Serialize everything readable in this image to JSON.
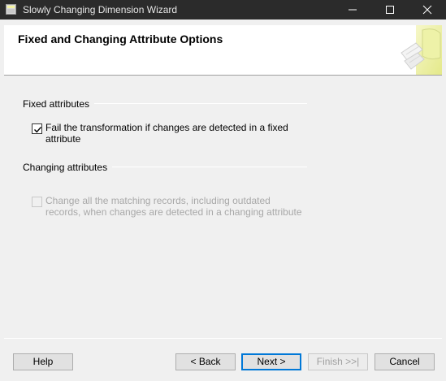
{
  "window": {
    "title": "Slowly Changing Dimension Wizard",
    "icon": "wizard-app-icon",
    "controls": {
      "minimize": "minimize-icon",
      "maximize": "maximize-icon",
      "close": "close-icon"
    }
  },
  "header": {
    "title": "Fixed and Changing Attribute Options",
    "art": "wizard-header-graphic"
  },
  "fixed_attributes": {
    "label": "Fixed attributes",
    "checkbox": {
      "label_line1": "Fail the transformation if changes are detected in a fixed",
      "label_line2": "attribute",
      "checked": true,
      "enabled": true
    }
  },
  "changing_attributes": {
    "label": "Changing attributes",
    "checkbox": {
      "label_line1": "Change all the matching records, including outdated",
      "label_line2": "records, when changes are detected in a changing attribute",
      "checked": false,
      "enabled": false
    }
  },
  "buttons": {
    "help": "Help",
    "back": "< Back",
    "next": "Next >",
    "finish": "Finish >>|",
    "cancel": "Cancel"
  },
  "colors": {
    "titlebar": "#2b2b2b",
    "window_bg": "#f0f0f0",
    "accent": "#0078d7",
    "disabled_text": "#a8a8a8"
  }
}
